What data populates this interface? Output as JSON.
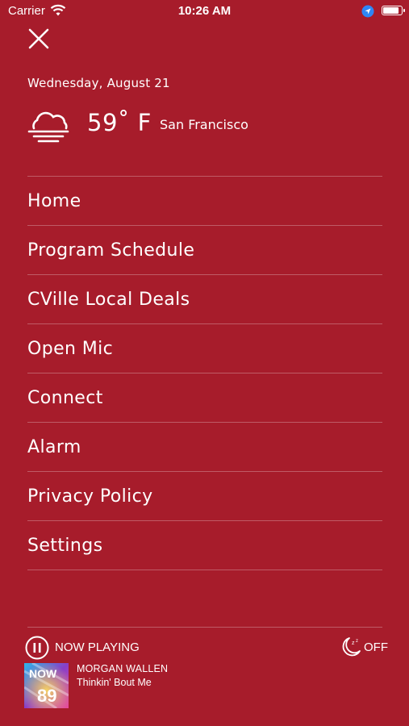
{
  "status_bar": {
    "carrier": "Carrier",
    "time": "10:26 AM"
  },
  "header": {
    "date": "Wednesday, August 21"
  },
  "weather": {
    "icon": "cloud-fog-icon",
    "temperature": "59˚ F",
    "city": "San Francisco"
  },
  "menu": {
    "items": [
      {
        "label": "Home"
      },
      {
        "label": "Program Schedule"
      },
      {
        "label": "CVille Local Deals"
      },
      {
        "label": "Open Mic"
      },
      {
        "label": "Connect"
      },
      {
        "label": "Alarm"
      },
      {
        "label": "Privacy Policy"
      },
      {
        "label": "Settings"
      }
    ]
  },
  "player": {
    "now_playing_label": "NOW PLAYING",
    "sleep_timer_label": "OFF",
    "artist": "MORGAN WALLEN",
    "song": "Thinkin' Bout Me",
    "album_art_text": "NOW 89"
  },
  "colors": {
    "background": "#A71C2B",
    "text": "#FFFFFF",
    "location_accent": "#2E86F5"
  }
}
